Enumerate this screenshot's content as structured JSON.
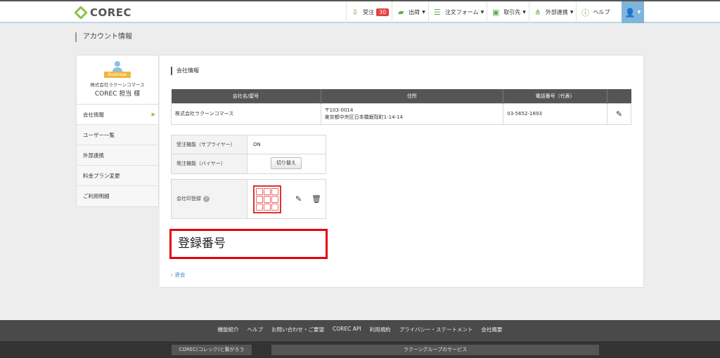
{
  "header": {
    "logo": "COREC",
    "nav": [
      {
        "icon": "receive-order-icon",
        "label": "受注",
        "badge": "30",
        "caret": ""
      },
      {
        "icon": "truck-icon",
        "label": "出荷",
        "badge": "",
        "caret": "▼"
      },
      {
        "icon": "order-form-icon",
        "label": "注文フォーム",
        "badge": "",
        "caret": "▼"
      },
      {
        "icon": "business-card-icon",
        "label": "取引先",
        "badge": "",
        "caret": "▼"
      },
      {
        "icon": "network-icon",
        "label": "外部連携",
        "badge": "",
        "caret": "▼"
      },
      {
        "icon": "help-icon",
        "label": "ヘルプ",
        "badge": "",
        "caret": ""
      }
    ],
    "user_caret": "▼"
  },
  "page_title": "アカウント情報",
  "sidebar": {
    "tag": "Business",
    "company": "株式会社ラクーンコマース",
    "user": "COREC 担当 様",
    "items": [
      {
        "label": "会社情報",
        "arrow": "▶"
      },
      {
        "label": "ユーザー一覧",
        "arrow": ""
      },
      {
        "label": "外部連携",
        "arrow": ""
      },
      {
        "label": "料金プラン変更",
        "arrow": ""
      },
      {
        "label": "ご利用明細",
        "arrow": ""
      }
    ]
  },
  "main": {
    "section_title": "会社情報",
    "company_table": {
      "headers": [
        "会社名/屋号",
        "住所",
        "電話番号（代表）",
        ""
      ],
      "row": {
        "name": "株式会社ラクーンコマース",
        "zip": "〒103-0014",
        "address": "東京都中央区日本橋蛎殻町1-14-14",
        "phone": "03-5652-1693"
      }
    },
    "functions": [
      {
        "label": "受注機能（サプライヤー）",
        "value": "ON"
      },
      {
        "label": "発注機能（バイヤー）",
        "button": "切り替え"
      }
    ],
    "seal_label": "会社印登録",
    "help_mark": "?",
    "registration_number": "登録番号",
    "withdraw_link": "退会"
  },
  "footer": {
    "links": [
      "機能紹介",
      "ヘルプ",
      "お問い合わせ・ご要望",
      "COREC API",
      "利用規約",
      "プライバシー・ステートメント",
      "会社概要"
    ],
    "btn_left": "COREC(コレック)と繋がろう",
    "btn_right": "ラクーングループのサービス"
  },
  "colors": {
    "accent_green": "#8bc34a",
    "badge_red": "#e4413f",
    "highlight_red": "#e8000b",
    "user_blue": "#7fb4dc"
  }
}
